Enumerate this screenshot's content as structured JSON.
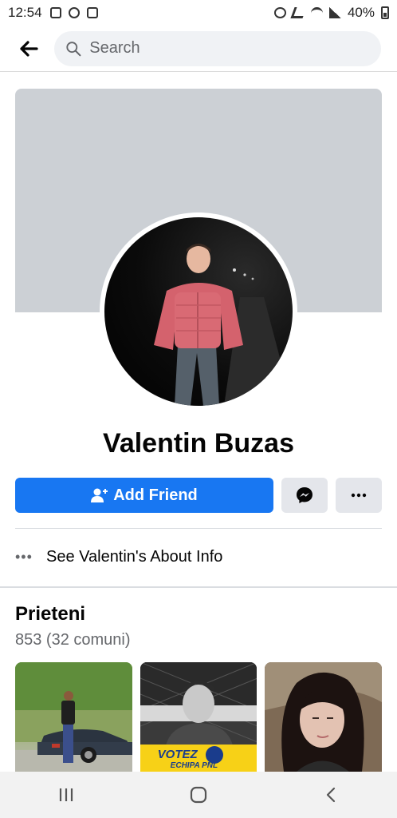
{
  "status_bar": {
    "time": "12:54",
    "battery": "40%",
    "icons": [
      "gallery-icon",
      "messenger-icon",
      "square-app-icon",
      "alarm-icon",
      "mute-icon",
      "wifi-icon",
      "signal-icon",
      "battery-icon"
    ]
  },
  "header": {
    "back_icon": "arrow-left-icon",
    "search_placeholder": "Search"
  },
  "profile": {
    "name": "Valentin Buzas",
    "add_friend_label": "Add Friend",
    "messenger_icon": "messenger-icon",
    "more_icon": "more-dots-icon",
    "about_label": "See Valentin's About Info"
  },
  "friends": {
    "title": "Prieteni",
    "count": "853 (32 comuni)",
    "cards": [
      {
        "image": "friend-photo-man-car"
      },
      {
        "image": "friend-photo-campaign-poster",
        "poster_text": "VOTEZ",
        "poster_subtext": "ECHIPA PNL"
      },
      {
        "image": "friend-photo-woman"
      }
    ]
  },
  "nav": {
    "icons": [
      "recent-apps-icon",
      "home-icon",
      "back-icon"
    ]
  },
  "colors": {
    "accent": "#1877f2",
    "cover": "#ccd0d5",
    "secondary_button": "#e4e6eb"
  }
}
